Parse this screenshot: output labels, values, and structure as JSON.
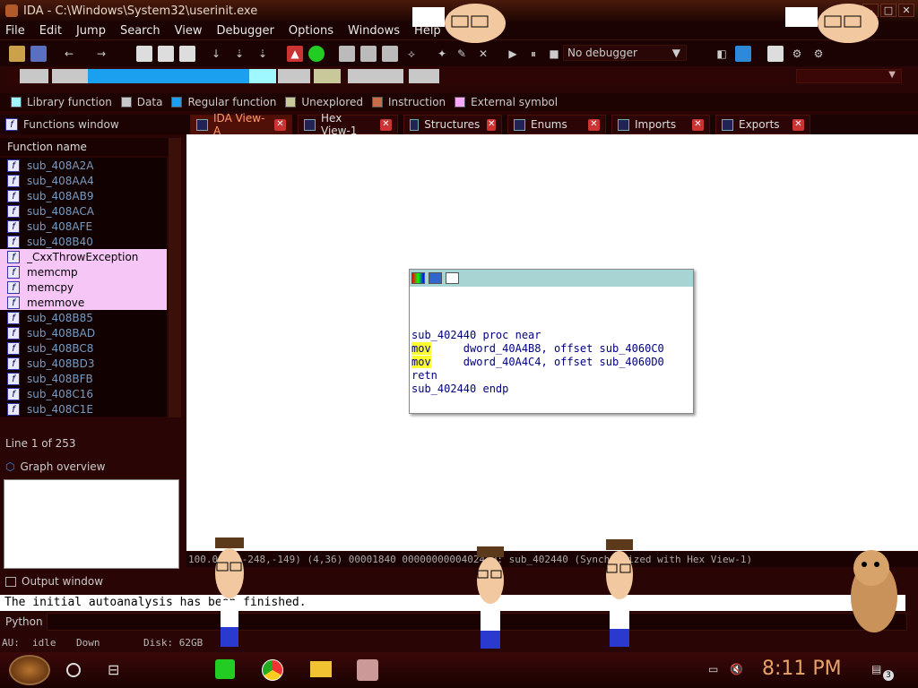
{
  "window": {
    "title": "IDA - C:\\Windows\\System32\\userinit.exe"
  },
  "menu": [
    "File",
    "Edit",
    "Jump",
    "Search",
    "View",
    "Debugger",
    "Options",
    "Windows",
    "Help"
  ],
  "toolbar": {
    "debugger": "No debugger"
  },
  "legend": [
    {
      "label": "Library function",
      "color": "#9ff8ff"
    },
    {
      "label": "Data",
      "color": "#c8c8c8"
    },
    {
      "label": "Regular function",
      "color": "#1aa0ee"
    },
    {
      "label": "Unexplored",
      "color": "#c8c89a"
    },
    {
      "label": "Instruction",
      "color": "#c86d4a"
    },
    {
      "label": "External symbol",
      "color": "#f9a9f9"
    }
  ],
  "functions_window": {
    "title": "Functions window",
    "column": "Function name",
    "items": [
      {
        "name": "sub_408A2A",
        "lib": false
      },
      {
        "name": "sub_408AA4",
        "lib": false
      },
      {
        "name": "sub_408AB9",
        "lib": false
      },
      {
        "name": "sub_408ACA",
        "lib": false
      },
      {
        "name": "sub_408AFE",
        "lib": false
      },
      {
        "name": "sub_408B40",
        "lib": false
      },
      {
        "name": "_CxxThrowException",
        "lib": true
      },
      {
        "name": "memcmp",
        "lib": true
      },
      {
        "name": "memcpy",
        "lib": true
      },
      {
        "name": "memmove",
        "lib": true
      },
      {
        "name": "sub_408B85",
        "lib": false
      },
      {
        "name": "sub_408BAD",
        "lib": false
      },
      {
        "name": "sub_408BC8",
        "lib": false
      },
      {
        "name": "sub_408BD3",
        "lib": false
      },
      {
        "name": "sub_408BFB",
        "lib": false
      },
      {
        "name": "sub_408C16",
        "lib": false
      },
      {
        "name": "sub_408C1E",
        "lib": false
      }
    ],
    "status": "Line 1 of 253"
  },
  "graph_overview": {
    "title": "Graph overview"
  },
  "tabs": [
    {
      "label": "IDA View-A",
      "active": true
    },
    {
      "label": "Hex View-1",
      "active": false
    },
    {
      "label": "Structures",
      "active": false
    },
    {
      "label": "Enums",
      "active": false
    },
    {
      "label": "Imports",
      "active": false
    },
    {
      "label": "Exports",
      "active": false
    }
  ],
  "code": {
    "line1": "sub_402440 proc near",
    "mov": "mov",
    "line2": "     dword_40A4B8, offset sub_4060C0",
    "line3": "     dword_40A4C4, offset sub_4060D0",
    "retn": "retn",
    "endp": "sub_402440 endp"
  },
  "view_status": "100.00% (-248,-149) (4,36) 00001840 0000000000402440: sub_402440 (Synchronized with Hex View-1)",
  "output": {
    "title": "Output window",
    "text": "The initial autoanalysis has been finished.",
    "python": "Python"
  },
  "status": {
    "au": "AU:",
    "state": "idle",
    "dir": "Down",
    "disk": "Disk: 62GB"
  },
  "taskbar": {
    "time": "8:11 PM",
    "notif": "3"
  }
}
